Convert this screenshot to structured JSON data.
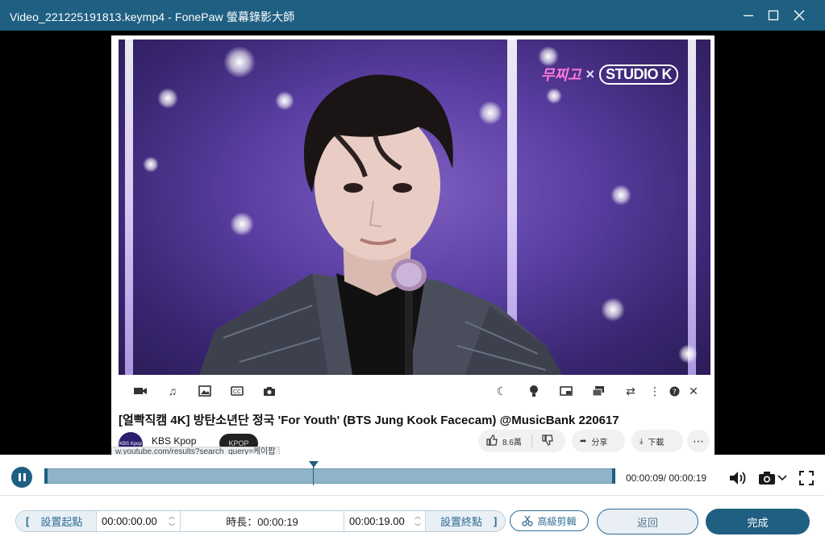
{
  "window": {
    "title": "Video_221225191813.keymp4  -  FonePaw 螢幕錄影大師"
  },
  "video": {
    "overlay_logo": {
      "left": "무찌고",
      "separator": "×",
      "right": "STUDIO K"
    },
    "yt_title": "[얼빡직캠 4K] 방탄소년단 정국 'For Youth' (BTS Jung Kook Facecam) @MusicBank 220617",
    "channel_avatar_text": "KBS Kpop",
    "channel_name": "KBS Kpop",
    "channel_thumb_text": "KPOP",
    "url_tooltip": "w.youtube.com/results?search_query=케이팝",
    "like_count": "8.6萬",
    "share_label": "分享",
    "download_label": "下載",
    "more_label": "⋯"
  },
  "timeline": {
    "progress_fraction": 0.47,
    "time_readout": "00:00:09/ 00:00:19"
  },
  "trim": {
    "set_start_label": "設置起點",
    "start_time": "00:00:00.00",
    "duration_label": "時長：00:00:19",
    "end_time": "00:00:19.00",
    "set_end_label": "設置終點",
    "bracket_open": "[",
    "bracket_close": "]"
  },
  "buttons": {
    "advanced_trim": "高級剪輯",
    "back": "返回",
    "done": "完成"
  },
  "colors": {
    "accent": "#1f5f82",
    "track": "#8fb3c8"
  }
}
